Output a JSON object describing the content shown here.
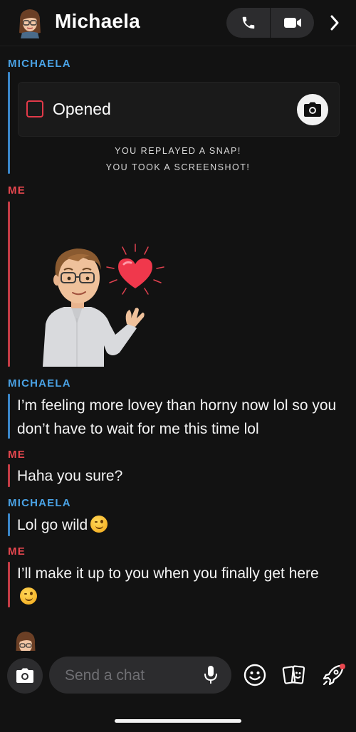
{
  "header": {
    "title": "Michaela",
    "avatar_icon": "bitmoji-avatar-icon",
    "call_icon": "phone-icon",
    "video_icon": "video-camera-icon",
    "more_icon": "chevron-right-icon"
  },
  "thread": {
    "senders": {
      "them": "MICHAELA",
      "me": "ME"
    },
    "snap": {
      "status": "Opened",
      "status_color": "#e23a49",
      "camera_icon": "camera-icon"
    },
    "notices": [
      "YOU REPLAYED A SNAP!",
      "YOU TOOK A SCREENSHOT!"
    ],
    "sticker": "bitmoji-heart-sticker",
    "messages": [
      {
        "sender": "MICHAELA",
        "text": "I’m feeling more lovey than horny now lol so you don’t have to wait for me this time lol"
      },
      {
        "sender": "ME",
        "text": "Haha you sure?"
      },
      {
        "sender": "MICHAELA",
        "text": "Lol go wild",
        "emoji": "winking-face-emoji"
      },
      {
        "sender": "ME",
        "text": "I’ll make it up to you when you finally get here",
        "emoji": "winking-face-emoji"
      }
    ]
  },
  "composer": {
    "placeholder": "Send a chat",
    "camera_icon": "camera-icon",
    "mic_icon": "microphone-icon",
    "emoji_icon": "smiley-icon",
    "sticker_icon": "stickers-icon",
    "games_icon": "rocket-icon"
  },
  "colors": {
    "them": "#4aa3e6",
    "me": "#e8474f",
    "background": "#121212"
  }
}
